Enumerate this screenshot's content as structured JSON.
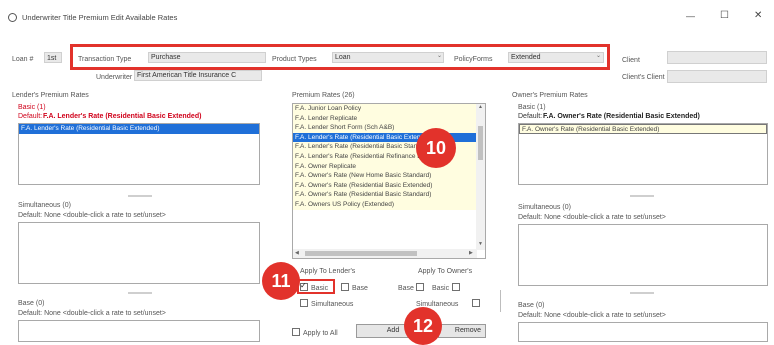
{
  "window": {
    "title": "Underwriter Title Premium Edit Available Rates",
    "controls": {
      "minimize": "—",
      "maximize": "☐",
      "close": "✕"
    }
  },
  "top": {
    "loan_label": "Loan #",
    "loan_value": "1st",
    "transaction_type_label": "Transaction Type",
    "transaction_type_value": "Purchase",
    "product_types_label": "Product Types",
    "product_types_value": "Loan",
    "policy_forms_label": "PolicyForms",
    "policy_forms_value": "Extended",
    "client_label": "Client",
    "clients_client_label": "Client's Client",
    "underwriter_label": "Underwriter",
    "underwriter_value": "First American Title Insurance C"
  },
  "lender": {
    "title": "Lender's Premium Rates",
    "basic_label": "Basic (1)",
    "basic_default_prefix": "Default:",
    "basic_default": "F.A. Lender's Rate (Residential Basic Extended)",
    "basic_items": [
      "F.A. Lender's Rate (Residential Basic Extended)"
    ],
    "simultaneous_label": "Simultaneous (0)",
    "simultaneous_default": "Default: None <double-click a rate to set/unset>",
    "base_label": "Base (0)",
    "base_default": "Default: None <double-click a rate to set/unset>"
  },
  "premium": {
    "title": "Premium Rates (26)",
    "items": [
      "F.A. Junior Loan Policy",
      "F.A. Lender Replicate",
      "F.A. Lender Short Form (Sch A&B)",
      "F.A. Lender's Rate (Residential Basic Extended)",
      "F.A. Lender's Rate (Residential Basic Standard)",
      "F.A. Lender's Rate (Residential Refinance Exten",
      "F.A. Owner Replicate",
      "F.A. Owner's Rate (New Home Basic Standard)",
      "F.A. Owner's Rate (Residential Basic Extended)",
      "F.A. Owner's Rate (Residential Basic Standard)",
      "F.A. Owners US Policy (Extended)"
    ],
    "apply_lenders_label": "Apply To Lender's",
    "apply_owners_label": "Apply To Owner's",
    "basic_label": "Basic",
    "base_label": "Base",
    "simultaneous_label": "Simultaneous",
    "apply_all_label": "Apply to All",
    "add_label": "Add",
    "remove_label": "Remove"
  },
  "owner": {
    "title": "Owner's Premium Rates",
    "basic_label": "Basic (1)",
    "basic_default_prefix": "Default:",
    "basic_default": "F.A. Owner's Rate (Residential Basic Extended)",
    "basic_items": [
      "F.A. Owner's Rate (Residential Basic Extended)"
    ],
    "simultaneous_label": "Simultaneous (0)",
    "simultaneous_default": "Default: None <double-click a rate to set/unset>",
    "base_label": "Base (0)",
    "base_default": "Default: None <double-click a rate to set/unset>"
  },
  "badges": {
    "b10": "10",
    "b11": "11",
    "b12": "12"
  },
  "colors": {
    "annotation": "#e2322b",
    "selection": "#1f6fd8",
    "default_text": "#d0021b"
  }
}
